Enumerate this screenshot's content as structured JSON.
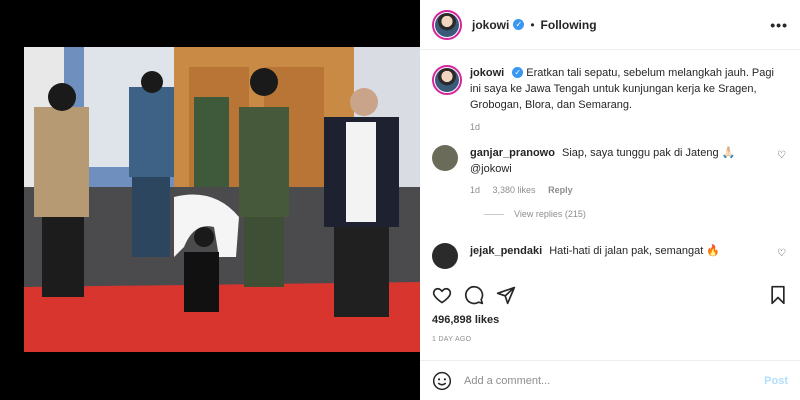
{
  "post": {
    "author": "jokowi",
    "follow_state": "Following",
    "separator": "•",
    "more": "•••"
  },
  "caption": {
    "username": "jokowi",
    "text": "Eratkan tali sepatu, sebelum melangkah jauh. Pagi ini saya ke Jawa Tengah untuk kunjungan kerja ke Sragen, Grobogan, Blora, dan Semarang.",
    "time": "1d"
  },
  "comments": [
    {
      "username": "ganjar_pranowo",
      "text": "Siap, saya tunggu pak di Jateng 🙏🏻 @jokowi",
      "time": "1d",
      "likes": "3,380 likes",
      "reply": "Reply",
      "view_replies": "View replies (215)",
      "avatar_color": "#6b6b5a"
    },
    {
      "username": "jejak_pendaki",
      "text": "Hati-hati di jalan pak, semangat 🔥",
      "avatar_color": "#2b2b2b"
    }
  ],
  "stats": {
    "likes": "496,898 likes",
    "posted": "1 DAY AGO"
  },
  "composer": {
    "placeholder": "Add a comment...",
    "post_label": "Post"
  },
  "icons": {
    "verified": "verified-badge-icon",
    "like": "heart-icon",
    "comment": "comment-bubble-icon",
    "share": "paper-plane-icon",
    "save": "bookmark-icon",
    "emoji": "smiley-icon"
  },
  "colors": {
    "verified": "#3897f0",
    "post_button": "#b2dffc",
    "muted": "#8e8e8e",
    "story_ring": "#d6249f"
  }
}
